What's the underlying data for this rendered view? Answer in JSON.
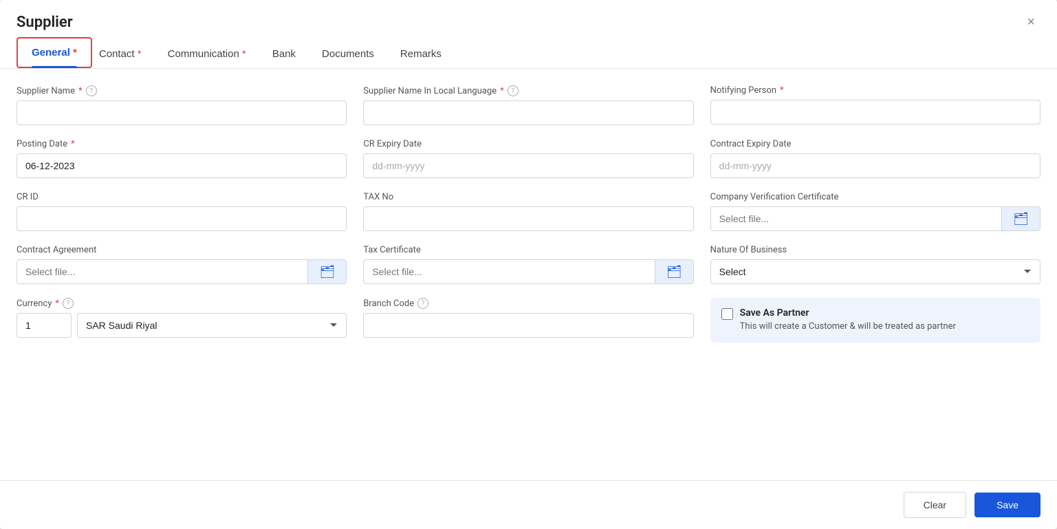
{
  "modal": {
    "title": "Supplier",
    "close_label": "×"
  },
  "tabs": [
    {
      "id": "general",
      "label": "General",
      "active": true,
      "required": true
    },
    {
      "id": "contact",
      "label": "Contact",
      "active": false,
      "required": true
    },
    {
      "id": "communication",
      "label": "Communication",
      "active": false,
      "required": true
    },
    {
      "id": "bank",
      "label": "Bank",
      "active": false,
      "required": false
    },
    {
      "id": "documents",
      "label": "Documents",
      "active": false,
      "required": false
    },
    {
      "id": "remarks",
      "label": "Remarks",
      "active": false,
      "required": false
    }
  ],
  "form": {
    "supplier_name_label": "Supplier Name",
    "supplier_name_placeholder": "",
    "supplier_name_local_label": "Supplier Name In Local Language",
    "supplier_name_local_placeholder": "",
    "notifying_person_label": "Notifying Person",
    "notifying_person_placeholder": "",
    "posting_date_label": "Posting Date",
    "posting_date_value": "06-12-2023",
    "cr_expiry_date_label": "CR Expiry Date",
    "cr_expiry_date_placeholder": "dd-mm-yyyy",
    "contract_expiry_date_label": "Contract Expiry Date",
    "contract_expiry_date_placeholder": "dd-mm-yyyy",
    "cr_id_label": "CR ID",
    "cr_id_placeholder": "",
    "tax_no_label": "TAX No",
    "tax_no_placeholder": "",
    "company_verification_label": "Company Verification Certificate",
    "select_file_placeholder": "Select file...",
    "contract_agreement_label": "Contract Agreement",
    "tax_certificate_label": "Tax Certificate",
    "nature_of_business_label": "Nature Of Business",
    "nature_select_default": "Select",
    "currency_label": "Currency",
    "currency_amount_value": "1",
    "currency_select_value": "SAR Saudi Riyal",
    "branch_code_label": "Branch Code",
    "branch_code_placeholder": "",
    "save_as_partner_title": "Save As Partner",
    "save_as_partner_desc": "This will create a Customer & will be treated as partner"
  },
  "footer": {
    "clear_label": "Clear",
    "save_label": "Save"
  },
  "icons": {
    "close": "×",
    "help": "?",
    "folder": "📁",
    "chevron": "▼"
  }
}
